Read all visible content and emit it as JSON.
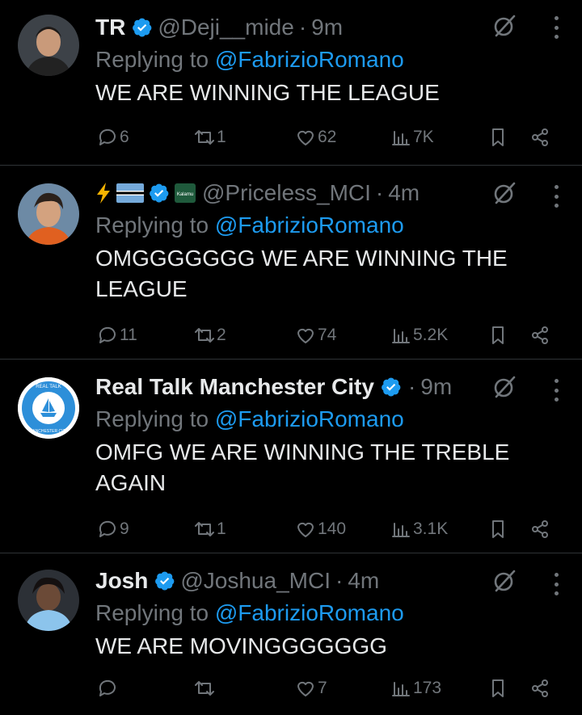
{
  "tweets": [
    {
      "name": "TR",
      "handle": "@Deji__mide",
      "time": "9m",
      "replying_prefix": "Replying to",
      "replying_to": "@FabrizioRomano",
      "text": "WE ARE WINNING THE LEAGUE",
      "replies": "6",
      "retweets": "1",
      "likes": "62",
      "views": "7K",
      "avatar_color": "#4a4f55"
    },
    {
      "name_emojis": [
        "lightning-emoji",
        "botswana-flag-emoji"
      ],
      "affiliate_badge": "Kalamu",
      "handle": "@Priceless_MCI",
      "time": "4m",
      "replying_prefix": "Replying to",
      "replying_to": "@FabrizioRomano",
      "text": "OMGGGGGGG WE ARE WINNING THE LEAGUE",
      "replies": "11",
      "retweets": "2",
      "likes": "74",
      "views": "5.2K",
      "avatar_color": "#5b7c9a"
    },
    {
      "name": "Real Talk Manchester City",
      "handle": "",
      "time": "9m",
      "replying_prefix": "Replying to",
      "replying_to": "@FabrizioRomano",
      "text": "OMFG WE ARE WINNING THE TREBLE AGAIN",
      "replies": "9",
      "retweets": "1",
      "likes": "140",
      "views": "3.1K",
      "logo_text_top": "REAL TALK",
      "logo_text_bottom": "MANCHESTER CITY",
      "avatar_color": "#2f8fd8"
    },
    {
      "name": "Josh",
      "handle": "@Joshua_MCI",
      "time": "4m",
      "replying_prefix": "Replying to",
      "replying_to": "@FabrizioRomano",
      "text": "WE ARE MOVINGGGGGGG",
      "replies": "",
      "retweets": "",
      "likes": "7",
      "views": "173",
      "avatar_color": "#3a3f46"
    }
  ],
  "colors": {
    "background": "#000000",
    "text": "#e7e9ea",
    "secondary": "#71767b",
    "accent": "#1d9bf0",
    "divider": "#2f3336"
  }
}
